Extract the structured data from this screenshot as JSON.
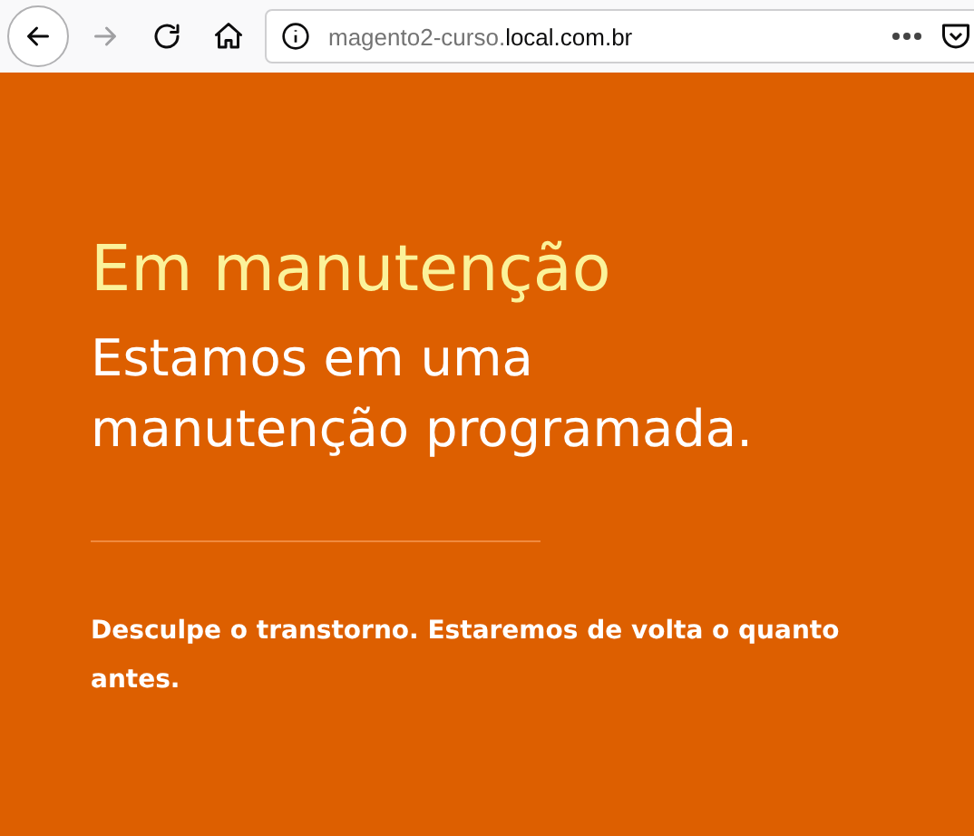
{
  "browser": {
    "url_subdomain": "magento2-curso.",
    "url_domain": "local.com.br",
    "back_enabled": true,
    "forward_enabled": false
  },
  "page": {
    "title": "Em manutenção",
    "subtitle": "Estamos em uma manutenção programada.",
    "message": "Desculpe o transtorno. Estaremos de volta o quanto antes."
  }
}
